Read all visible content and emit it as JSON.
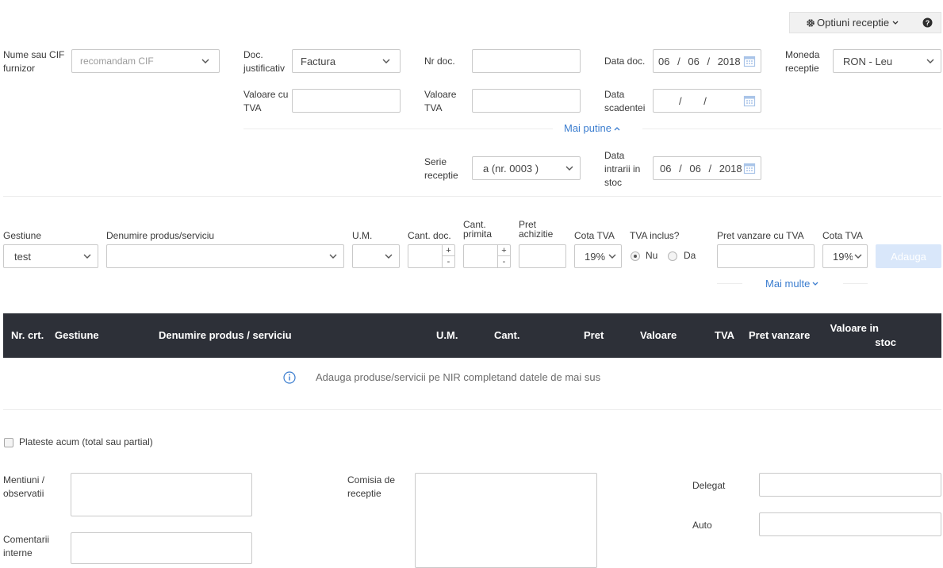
{
  "header": {
    "options_label": "Optiuni receptie",
    "options_icon": "gear-icon",
    "help_icon": "question-circle-icon"
  },
  "supplier": {
    "label_line1": "Nume sau CIF",
    "label_line2": "furnizor",
    "placeholder": "recomandam CIF"
  },
  "doc_type": {
    "label_line1": "Doc.",
    "label_line2": "justificativ",
    "value": "Factura"
  },
  "doc_number": {
    "label": "Nr doc.",
    "value": ""
  },
  "doc_date": {
    "label": "Data doc.",
    "day": "06",
    "month": "06",
    "year": "2018"
  },
  "currency": {
    "label_line1": "Moneda",
    "label_line2": "receptie",
    "value": "RON - Leu"
  },
  "value_with_vat": {
    "label_line1": "Valoare cu",
    "label_line2": "TVA",
    "value": ""
  },
  "vat_value": {
    "label_line1": "Valoare",
    "label_line2": "TVA",
    "value": ""
  },
  "due_date": {
    "label_line1": "Data",
    "label_line2": "scadentei",
    "day": "",
    "month": "",
    "year": ""
  },
  "less_link": "Mai putine",
  "reception_series": {
    "label_line1": "Serie",
    "label_line2": "receptie",
    "value": "a (nr. 0003 )"
  },
  "stock_date": {
    "label_line1": "Data",
    "label_line2": "intrarii in",
    "label_line3": "stoc",
    "day": "06",
    "month": "06",
    "year": "2018"
  },
  "product_row": {
    "warehouse_label": "Gestiune",
    "warehouse_value": "test",
    "product_label": "Denumire produs/serviciu",
    "unit_label": "U.M.",
    "qty_doc_label": "Cant. doc.",
    "qty_received_label_line1": "Cant.",
    "qty_received_label_line2": "primita",
    "price_label_line1": "Pret",
    "price_label_line2": "achizitie",
    "vat_rate_label": "Cota TVA",
    "vat_rate_value": "19%",
    "vat_included_label": "TVA inclus?",
    "vat_included_no": "Nu",
    "vat_included_yes": "Da",
    "sale_price_label": "Pret vanzare cu TVA",
    "sale_vat_rate_label": "Cota TVA",
    "sale_vat_rate_value": "19%",
    "add_button": "Adauga",
    "more_link": "Mai multe"
  },
  "table": {
    "columns": [
      "Nr. crt.",
      "Gestiune",
      "Denumire produs / serviciu",
      "U.M.",
      "Cant.",
      "Pret",
      "Valoare",
      "TVA",
      "Pret vanzare",
      "Valoare in",
      "stoc"
    ],
    "empty_message": "Adauga produse/servicii pe NIR completand datele de mai sus"
  },
  "payment": {
    "label": "Plateste acum (total sau partial)",
    "checked": false
  },
  "notes": {
    "mentions_line1": "Mentiuni /",
    "mentions_line2": "observatii",
    "internal_line1": "Comentarii",
    "internal_line2": "interne",
    "committee_line1": "Comisia de",
    "committee_line2": "receptie",
    "delegate_label": "Delegat",
    "auto_label": "Auto"
  },
  "colors": {
    "accent": "#3b7dcf",
    "table_header": "#2d3038",
    "add_button": "#d9e7fa"
  }
}
